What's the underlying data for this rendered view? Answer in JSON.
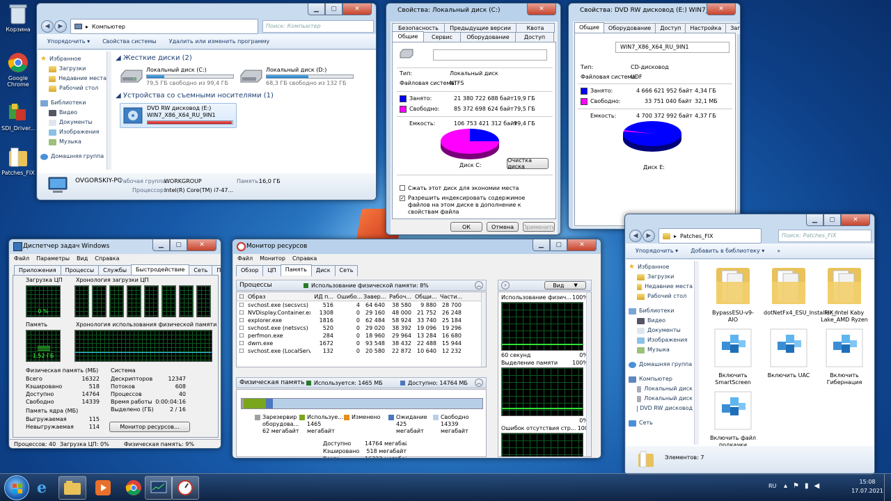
{
  "desktop": {
    "icons": [
      {
        "label": "Корзина"
      },
      {
        "label": "Google Chrome"
      },
      {
        "label": "SDI_Driver..."
      },
      {
        "label": "Patches_FIX"
      }
    ]
  },
  "explorer": {
    "address": "Компьютер",
    "search_placeholder": "Поиск: Компьютер",
    "cmd": [
      "Упорядочить ▾",
      "Свойства системы",
      "Удалить или изменить программу"
    ],
    "nav": [
      "Избранное",
      "Загрузки",
      "Недавние места",
      "Рабочий стол",
      "Библиотеки",
      "Видео",
      "Документы",
      "Изображения",
      "Музыка",
      "Домашняя группа"
    ],
    "hdd_header": "Жесткие диски (2)",
    "drives": [
      {
        "name": "Локальный диск (C:)",
        "free": "79,5 ГБ свободно из 99,4 ГБ",
        "used_fraction": 0.2
      },
      {
        "name": "Локальный диск (D:)",
        "free": "68,3 ГБ свободно из 132 ГБ",
        "used_fraction": 0.48
      }
    ],
    "removable_header": "Устройства со съемными носителями (1)",
    "dvd": {
      "name": "DVD RW дисковод (E:)",
      "label": "WIN7_X86_X64_RU_9IN1"
    },
    "pc_name": "OVGORSKIY-PC",
    "workgroup_label": "Рабочая группа:",
    "workgroup": "WORKGROUP",
    "memory_label": "Память:",
    "memory": "16,0 ГБ",
    "cpu_label": "Процессор:",
    "cpu": "Intel(R) Core(TM) i7-47..."
  },
  "propC": {
    "title": "Свойства: Локальный диск (C:)",
    "tabs_row1": [
      "Безопасность",
      "Предыдущие версии",
      "Квота"
    ],
    "tabs_row2": [
      "Общие",
      "Сервис",
      "Оборудование",
      "Доступ"
    ],
    "type_label": "Тип:",
    "type": "Локальный диск",
    "fs_label": "Файловая система:",
    "fs": "NTFS",
    "used_label": "Занято:",
    "used_bytes": "21 380 722 688 байт",
    "used_gb": "19,9 ГБ",
    "free_label": "Свободно:",
    "free_bytes": "85 372 698 624 байт",
    "free_gb": "79,5 ГБ",
    "cap_label": "Емкость:",
    "cap_bytes": "106 753 421 312 байт",
    "cap_gb": "99,4 ГБ",
    "disk_label": "Диск C:",
    "cleanup": "Очистка диска",
    "compress": "Сжать этот диск для экономии места",
    "index": "Разрешить индексировать содержимое файлов на этом диске в дополнение к свойствам файла",
    "ok": "ОК",
    "cancel": "Отмена",
    "apply": "Применить",
    "used_color": "#0000ff",
    "free_color": "#ff00ff"
  },
  "propE": {
    "title": "Свойства: DVD RW дисковод (E:) WIN7_X86_X64_RU...",
    "tabs": [
      "Общие",
      "Оборудование",
      "Доступ",
      "Настройка",
      "Запись"
    ],
    "label": "WIN7_X86_X64_RU_9IN1",
    "type_label": "Тип:",
    "type": "CD-дисковод",
    "fs_label": "Файловая система:",
    "fs": "UDF",
    "used_label": "Занято:",
    "used_bytes": "4 666 621 952 байт",
    "used_gb": "4,34 ГБ",
    "free_label": "Свободно:",
    "free_bytes": "33 751 040 байт",
    "free_gb": "32,1 МБ",
    "cap_label": "Емкость:",
    "cap_bytes": "4 700 372 992 байт",
    "cap_gb": "4,37 ГБ",
    "disk_label": "Диск E:"
  },
  "patches": {
    "address": "Patches_FIX",
    "search_placeholder": "Поиск: Patches_FIX",
    "cmd": [
      "Упорядочить ▾",
      "Добавить в библиотеку ▾",
      "»"
    ],
    "nav": [
      "Избранное",
      "Загрузки",
      "Недавние места",
      "Рабочий стол",
      "Библиотеки",
      "Видео",
      "Документы",
      "Изображения",
      "Музыка",
      "Домашняя группа",
      "Компьютер",
      "Локальный диск",
      "Локальный диск",
      "DVD RW дисковод",
      "Сеть"
    ],
    "items": [
      {
        "label": "BypassESU-v9-AIO",
        "kind": "folder"
      },
      {
        "label": "dotNetFx4_ESU_Installer_r",
        "kind": "folder"
      },
      {
        "label": "FIX_Intel Kaby Lake_AMD Ryzen",
        "kind": "folder"
      },
      {
        "label": "Включить SmartScreen",
        "kind": "reg"
      },
      {
        "label": "Включить UAC",
        "kind": "reg"
      },
      {
        "label": "Включить Гибернация",
        "kind": "reg"
      },
      {
        "label": "Включить файл подкачки",
        "kind": "reg"
      }
    ],
    "status": "Элементов: 7"
  },
  "taskmgr": {
    "title": "Диспетчер задач Windows",
    "menu": [
      "Файл",
      "Параметры",
      "Вид",
      "Справка"
    ],
    "tabs": [
      "Приложения",
      "Процессы",
      "Службы",
      "Быстродействие",
      "Сеть",
      "Пользователи"
    ],
    "cpu_usage_label": "Загрузка ЦП",
    "cpu_usage": "0 %",
    "cpu_history_label": "Хронология загрузки ЦП",
    "mem_label": "Память",
    "mem_value": "1,52 ГБ",
    "mem_history_label": "Хронология использования физической памяти",
    "phys_header": "Физическая память (МБ)",
    "phys": [
      [
        "Всего",
        "16322"
      ],
      [
        "Кэшировано",
        "518"
      ],
      [
        "Доступно",
        "14764"
      ],
      [
        "Свободно",
        "14339"
      ]
    ],
    "kernel_header": "Память ядра (МБ)",
    "kernel": [
      [
        "Выгружаемая",
        "115"
      ],
      [
        "Невыгружаемая",
        "114"
      ]
    ],
    "sys_header": "Система",
    "sys": [
      [
        "Дескрипторов",
        "12347"
      ],
      [
        "Потоков",
        "608"
      ],
      [
        "Процессов",
        "40"
      ],
      [
        "Время работы",
        "0:00:04:16"
      ],
      [
        "Выделено (ГБ)",
        "2 / 16"
      ]
    ],
    "resmon_button": "Монитор ресурсов...",
    "status": [
      "Процессов: 40",
      "Загрузка ЦП: 0%",
      "Физическая память: 9%"
    ]
  },
  "resmon": {
    "title": "Монитор ресурсов",
    "menu": [
      "Файл",
      "Монитор",
      "Справка"
    ],
    "tabs": [
      "Обзор",
      "ЦП",
      "Память",
      "Диск",
      "Сеть"
    ],
    "proc_header": "Процессы",
    "proc_usage": "Использование физической памяти: 8%",
    "cols": [
      "Образ",
      "ИД п...",
      "Ошибо...",
      "Завер...",
      "Рабоч...",
      "Общи...",
      "Части..."
    ],
    "rows": [
      [
        "svchost.exe (secsvcs)",
        "516",
        "4",
        "64 640",
        "38 580",
        "9 880",
        "28 700"
      ],
      [
        "NVDisplay.Container.exe",
        "1308",
        "0",
        "29 160",
        "48 000",
        "21 752",
        "26 248"
      ],
      [
        "explorer.exe",
        "1816",
        "0",
        "62 484",
        "58 924",
        "33 740",
        "25 184"
      ],
      [
        "svchost.exe (netsvcs)",
        "520",
        "0",
        "29 020",
        "38 392",
        "19 096",
        "19 296"
      ],
      [
        "perfmon.exe",
        "284",
        "0",
        "18 960",
        "29 964",
        "13 284",
        "16 680"
      ],
      [
        "dwm.exe",
        "1672",
        "0",
        "93 548",
        "38 432",
        "22 488",
        "15 944"
      ],
      [
        "svchost.exe (LocalServiceNet...",
        "132",
        "0",
        "20 580",
        "22 872",
        "10 640",
        "12 232"
      ]
    ],
    "phys_header": "Физическая память",
    "phys_used": "Используется: 1465 МБ",
    "phys_avail": "Доступно: 14764 МБ",
    "legend": [
      {
        "name": "Зарезервир оборудова...",
        "value": "62 мегабайт",
        "color": "#a0a0a0"
      },
      {
        "name": "Используе...",
        "value": "1465 мегабайт",
        "color": "#7aa61e"
      },
      {
        "name": "Изменено",
        "value": "",
        "color": "#e2901a"
      },
      {
        "name": "Ожидание",
        "value": "425 мегабайт",
        "color": "#4a77c0"
      },
      {
        "name": "Свободно",
        "value": "14339 мегабайт",
        "color": "#b8cfe8"
      }
    ],
    "summary": [
      [
        "Доступно",
        "14764 мегабайт"
      ],
      [
        "Кэшировано",
        "518 мегабайт"
      ],
      [
        "Всего",
        "16322 мегабайт"
      ],
      [
        "Установлено",
        "16384 мегабайт"
      ]
    ],
    "view_label": "Вид",
    "graphs": [
      {
        "title": "Использование физич...",
        "max": "100%",
        "foot_l": "60 секунд",
        "foot_r": "0%"
      },
      {
        "title": "Выделение памяти",
        "max": "100%",
        "foot_l": "",
        "foot_r": "0%"
      },
      {
        "title": "Ошибок отсутствия стр...",
        "max": "100",
        "foot_l": "",
        "foot_r": ""
      }
    ]
  },
  "taskbar": {
    "lang": "RU",
    "time": "15:08",
    "date": "17.07.2021"
  }
}
